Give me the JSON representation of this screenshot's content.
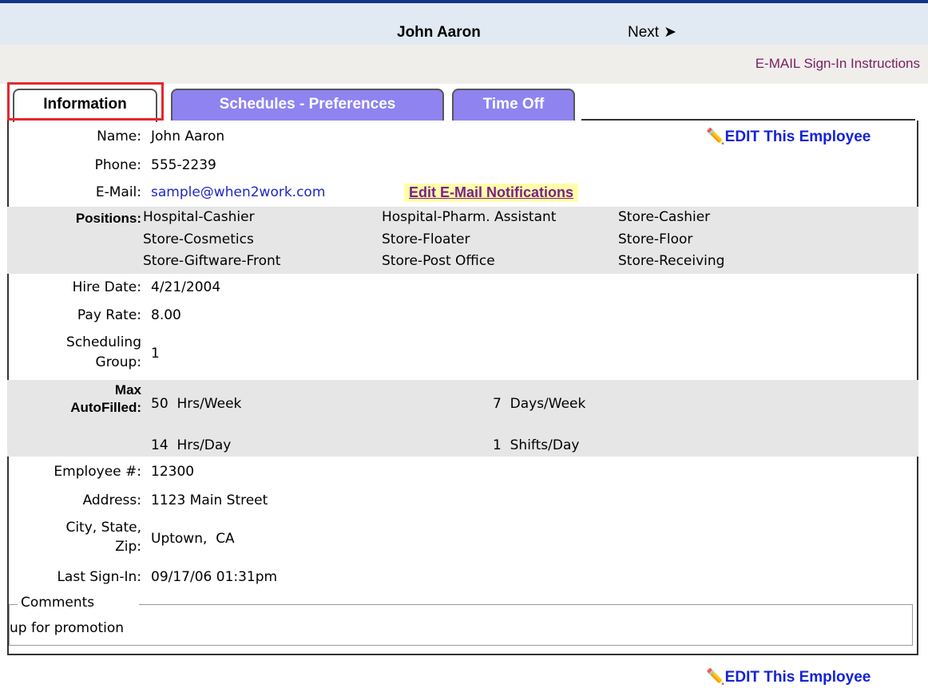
{
  "header": {
    "employee_name": "John Aaron",
    "next_label": "Next",
    "email_instructions": "E-MAIL Sign-In Instructions"
  },
  "tabs": [
    {
      "label": "Information",
      "active": true
    },
    {
      "label": "Schedules - Preferences",
      "active": false
    },
    {
      "label": "Time Off",
      "active": false
    }
  ],
  "edit_employee_label": "EDIT This Employee",
  "fields": {
    "name_label": "Name:",
    "name": "John Aaron",
    "phone_label": "Phone:",
    "phone": "555-2239",
    "email_label": "E-Mail:",
    "email": "sample@when2work.com",
    "edit_notifications": "Edit E-Mail Notifications",
    "positions_label": "Positions:",
    "positions": [
      [
        "Hospital-Cashier",
        "Hospital-Pharm. Assistant",
        "Store-Cashier"
      ],
      [
        "Store-Cosmetics",
        "Store-Floater",
        "Store-Floor"
      ],
      [
        "Store-Giftware-Front",
        "Store-Post Office",
        "Store-Receiving"
      ]
    ],
    "hire_date_label": "Hire Date:",
    "hire_date": "4/21/2004",
    "pay_rate_label": "Pay Rate:",
    "pay_rate": "8.00",
    "scheduling_group_label_1": "Scheduling",
    "scheduling_group_label_2": "Group:",
    "scheduling_group": "1",
    "max_autofilled_label_1": "Max",
    "max_autofilled_label_2": "AutoFilled:",
    "max_hrs_week": "50  Hrs/Week",
    "max_days_week": "7  Days/Week",
    "max_hrs_day": "14  Hrs/Day",
    "max_shifts_day": "1  Shifts/Day",
    "employee_num_label": "Employee #:",
    "employee_num": "12300",
    "address_label": "Address:",
    "address": "1123 Main Street",
    "city_label_1": "City, State,",
    "city_label_2": "Zip:",
    "city": "Uptown,  CA",
    "last_signin_label": "Last Sign-In:",
    "last_signin": "09/17/06 01:31pm",
    "comments_label": "Comments",
    "comments": "up for promotion"
  },
  "colors": {
    "tab_inactive": "#8f83f0",
    "highlight_border": "#e3282f",
    "link_blue": "#1422d8"
  }
}
